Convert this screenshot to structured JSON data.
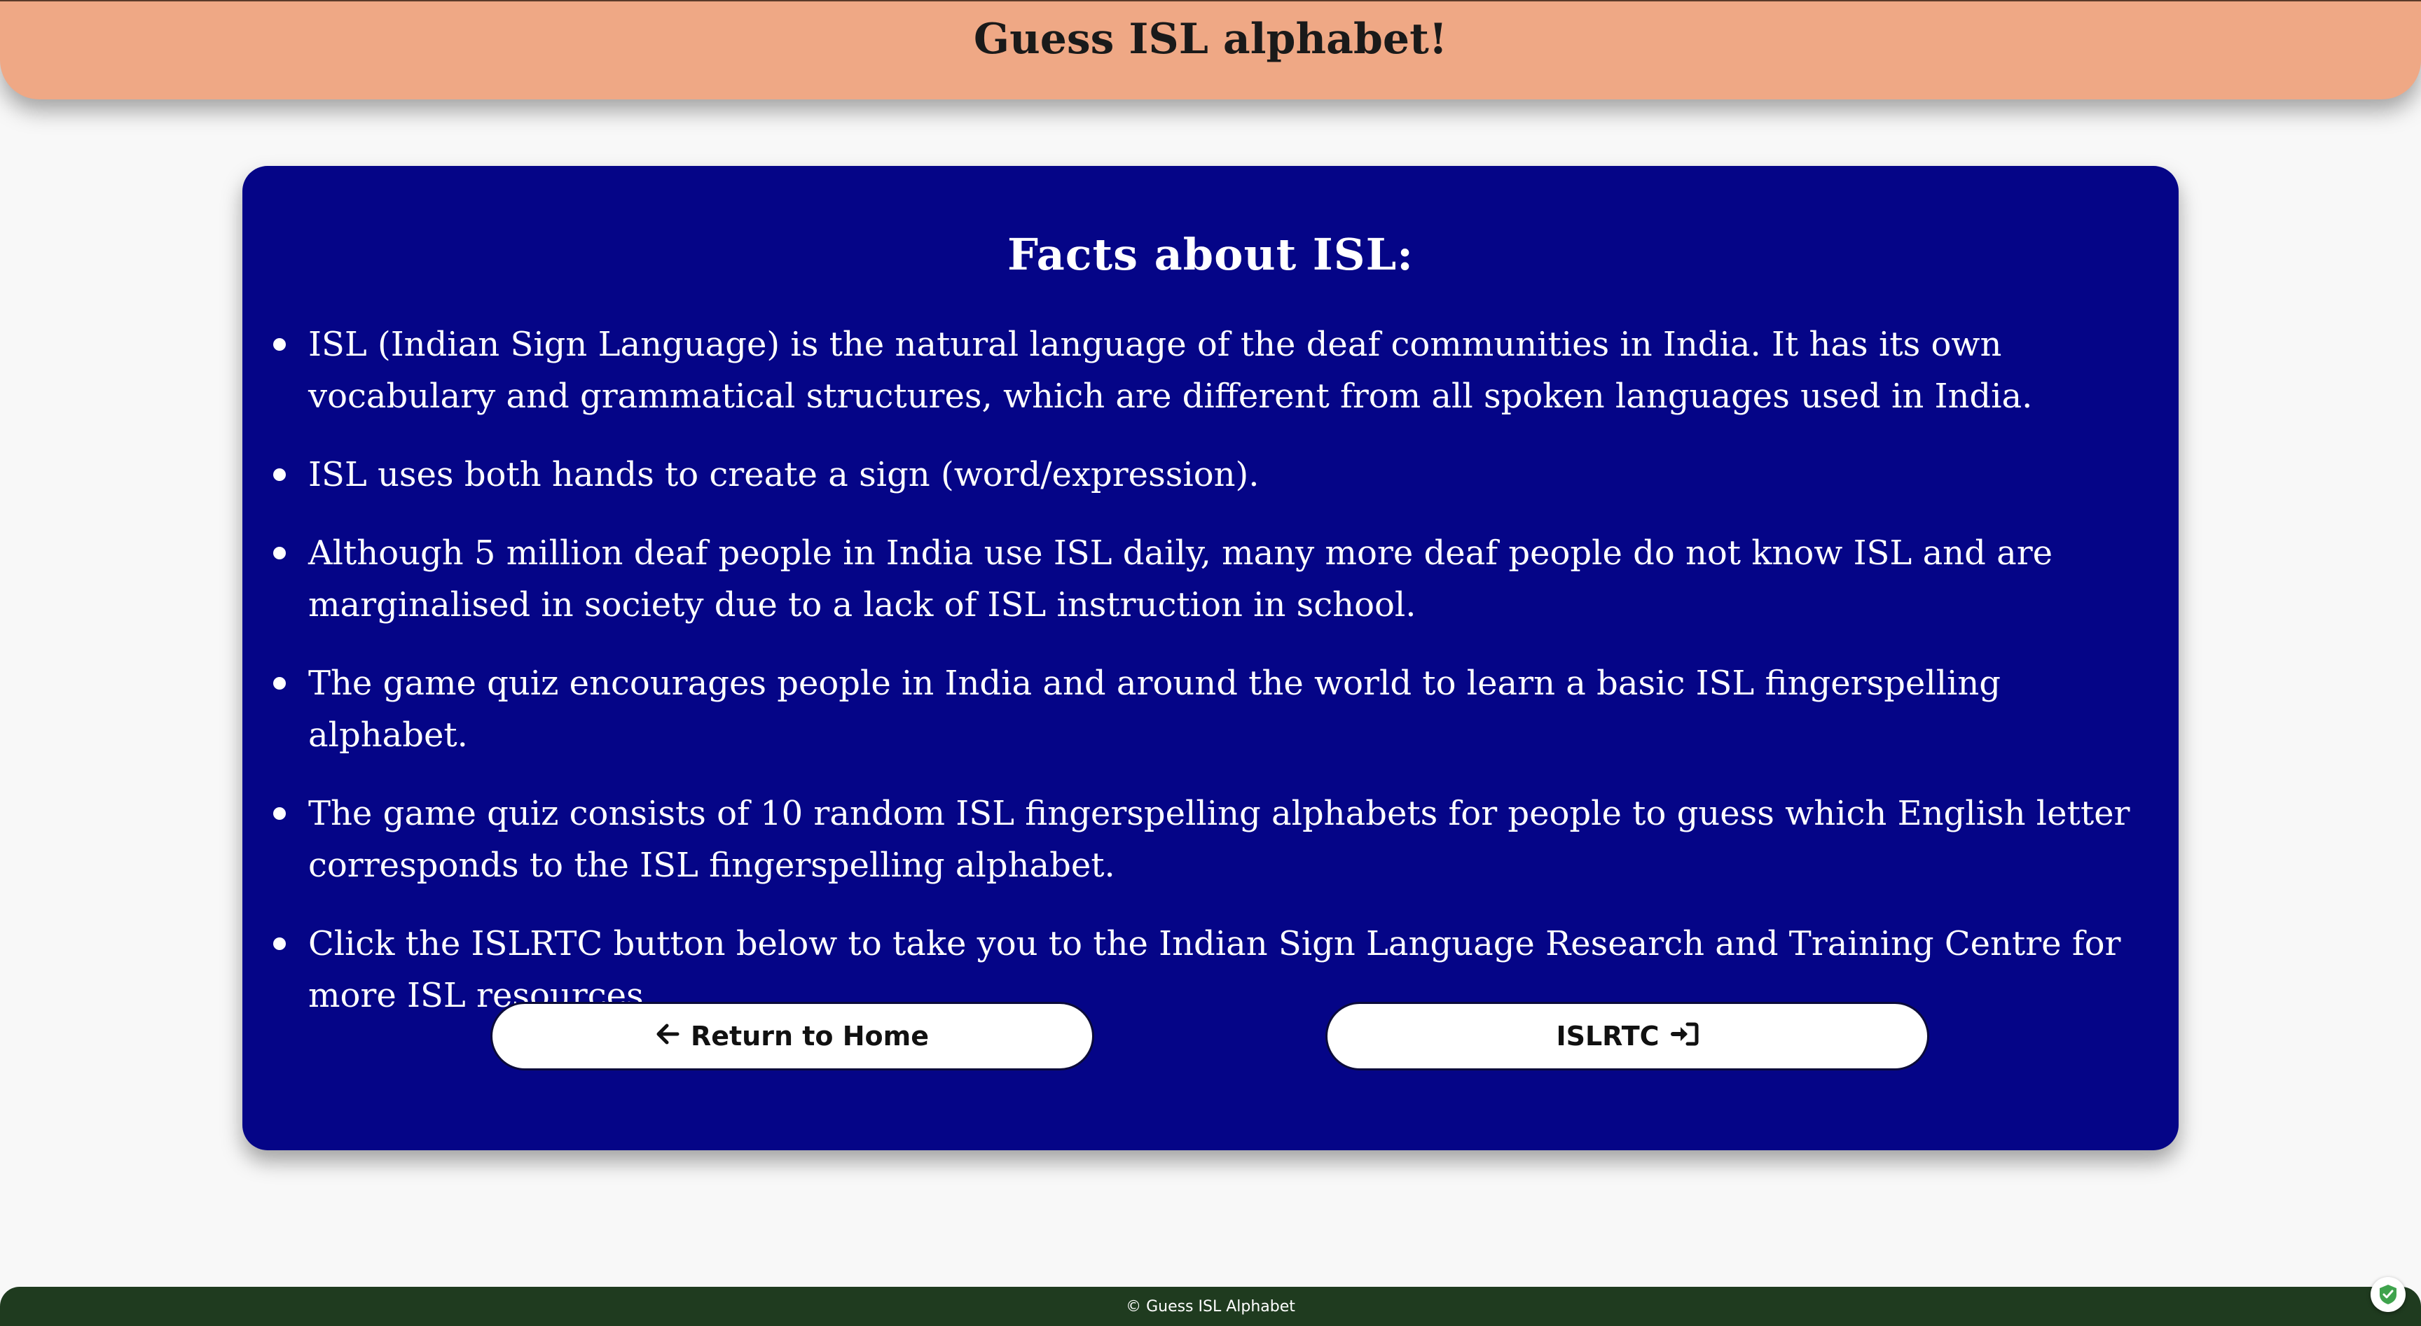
{
  "header": {
    "title": "Guess ISL alphabet!"
  },
  "card": {
    "heading": "Facts about ISL:",
    "facts": [
      "ISL (Indian Sign Language) is the natural language of the deaf communities in India. It has its own vocabulary and grammatical structures, which are different from all spoken languages used in India.",
      "ISL uses both hands to create a sign (word/expression).",
      "Although 5 million deaf people in India use ISL daily, many more deaf people do not know ISL and are marginalised in society due to a lack of ISL instruction in school.",
      "The game quiz encourages people in India and around the world to learn a basic ISL fingerspelling alphabet.",
      "The game quiz consists of 10 random ISL fingerspelling alphabets for people to guess which English letter corresponds to the ISL fingerspelling alphabet.",
      "Click the ISLRTC button below to take you to the Indian Sign Language Research and Training Centre for more ISL resources."
    ],
    "buttons": {
      "home_label": "Return to Home",
      "home_icon": "arrow-left-icon",
      "islrtc_label": "ISLRTC",
      "islrtc_icon": "sign-in-icon"
    }
  },
  "footer": {
    "text": "© Guess ISL Alphabet"
  },
  "colors": {
    "header_bg": "#efa885",
    "card_bg": "#050587",
    "footer_bg": "#1f3b1f",
    "page_bg": "#f8f8f8"
  }
}
